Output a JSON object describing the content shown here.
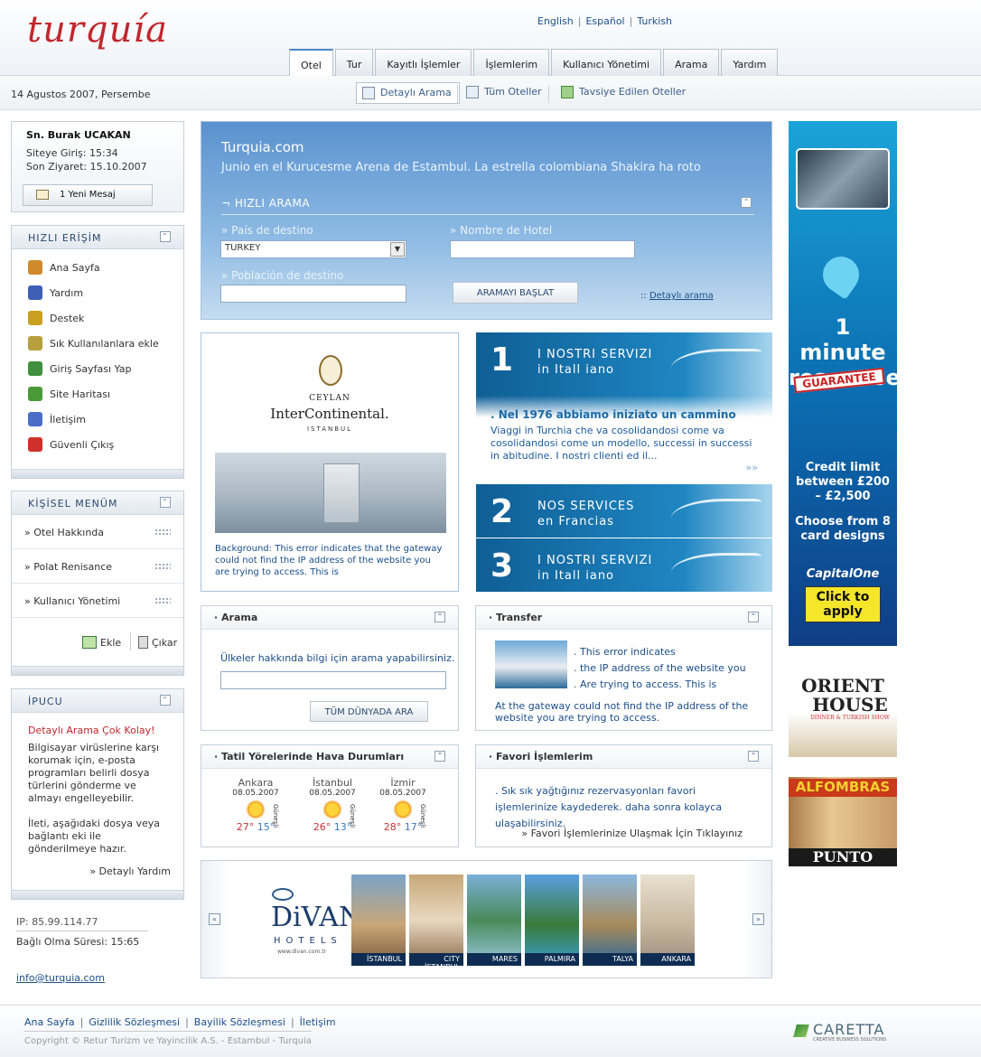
{
  "header": {
    "logo": "turquía",
    "langs": [
      "English",
      "Español",
      "Turkish"
    ],
    "tabs": [
      "Otel",
      "Tur",
      "Kayıtlı İşlemler",
      "İşlemlerim",
      "Kullanıcı Yönetimi",
      "Arama",
      "Yardım"
    ],
    "active_tab": "Otel"
  },
  "subbar": {
    "date": "14 Agustos 2007, Persembe",
    "tools": [
      "Detaylı Arama",
      "Tüm Oteller",
      "Tavsiye Edilen Oteller"
    ]
  },
  "user": {
    "name": "Sn. Burak UCAKAN",
    "login": "Siteye Giriş:  15:34",
    "last_visit": "Son Ziyaret: 15.10.2007",
    "messages": "1 Yeni Mesaj"
  },
  "quick_access": {
    "title": "HIZLI ERİŞİM",
    "items": [
      "Ana Sayfa",
      "Yardım",
      "Destek",
      "Sık Kullanılanlara ekle",
      "Giriş Sayfası Yap",
      "Site Haritası",
      "İletişim",
      "Güvenli Çıkış"
    ],
    "icon_colors": [
      "#d08a2e",
      "#3f5fb5",
      "#c9a020",
      "#b8a040",
      "#3f8f3f",
      "#4a9a3a",
      "#4a6ec8",
      "#d0302a"
    ]
  },
  "personal_menu": {
    "title": "KİŞİSEL MENÜM",
    "items": [
      "» Otel Hakkında",
      "» Polat Renisance",
      "» Kullanıcı Yönetimi"
    ],
    "add": "Ekle",
    "remove": "Çıkar"
  },
  "tip": {
    "title": "İPUCU",
    "heading": "Detaylı Arama Çok Kolay!",
    "body1": "Bilgisayar virüslerine karşı korumak için, e-posta programları belirli dosya türlerini gönderme ve almayı engelleyebilir.",
    "body2": "İleti, aşağıdaki dosya veya bağlantı eki ile gönderilmeye hazır.",
    "link": "» Detaylı Yardım"
  },
  "session": {
    "ip": "IP: 85.99.114.77",
    "duration": "Bağlı Olma Süresi: 15:65",
    "email": "info@turquia.com"
  },
  "search": {
    "site": "Turquia.com",
    "tagline": "Junio en el Kurucesme Arena de Estambul. La estrella colombiana Shakira ha roto",
    "title": "¬ HIZLI ARAMA",
    "country_label": "» País de destino",
    "country_value": "TURKEY",
    "hotel_label": "» Nombre de Hotel",
    "city_label": "» Población de destino",
    "button": "ARAMAYI BAŞLAT",
    "detail_prefix": "::",
    "detail_link": "Detaylı arama"
  },
  "hotel_promo": {
    "brand_top": "CEYLAN",
    "brand": "InterContinental.",
    "city": "ISTANBUL",
    "text": "Background: This error indicates that the gateway could not find the IP address of the website you are trying to access. This is"
  },
  "services": [
    {
      "num": "1",
      "line1": "I NOSTRI SERVIZI",
      "line2": "in Itall iano"
    },
    {
      "num": "2",
      "line1": "NOS SERVICES",
      "line2": "en Francias"
    },
    {
      "num": "3",
      "line1": "I NOSTRI SERVIZI",
      "line2": "in Itall iano"
    }
  ],
  "service_news": {
    "headline": ". Nel 1976 abbiamo iniziato un cammino",
    "body": "Viaggi in Turchia che va cosolidandosi  come va cosolidandosi  come un modello,  successi in successi in  abitudine. I nostri clienti ed il...",
    "more": "»»"
  },
  "arama_box": {
    "title": "Arama",
    "text": "Ülkeler hakkında bilgi için arama yapabilirsiniz.",
    "button": "TÜM DÜNYADA ARA"
  },
  "transfer_box": {
    "title": "Transfer",
    "lines": [
      ". This error indicates",
      ". the IP address of the website you",
      ". Are trying to access. This is"
    ],
    "footer": "At the gateway could not find the IP address of the website you are trying to access."
  },
  "weather": {
    "title": "Tatil Yörelerinde Hava Durumları",
    "cities": [
      {
        "name": "Ankara",
        "date": "08.05.2007",
        "cond": "Güneşli",
        "hi": "27°",
        "lo": "15°"
      },
      {
        "name": "İstanbul",
        "date": "08.05.2007",
        "cond": "Güneşli",
        "hi": "26°",
        "lo": "13°"
      },
      {
        "name": "İzmir",
        "date": "08.05.2007",
        "cond": "Güneşli",
        "hi": "28°",
        "lo": "17°"
      }
    ]
  },
  "favorites": {
    "title": "Favori İşlemlerim",
    "text": ". Sık sık yağtığınız rezervasyonları favori işlemlerinize kaydederek. daha sonra kolayca ulaşabilirsiniz.",
    "link": "» Favori İşlemlerinize Ulaşmak İçin Tıklayınız"
  },
  "divan": {
    "brand": "DiVAN",
    "sub": "HOTELS",
    "url": "www.divan.com.tr",
    "photos": [
      "İSTANBUL",
      "CITY İSTANBUL",
      "MARES",
      "PALMIRA",
      "TALYA",
      "ANKARA"
    ]
  },
  "ads": {
    "capital_one": {
      "headline": "1 minute response",
      "badge": "GUARANTEE",
      "limit": "Credit limit between £200 – £2,500",
      "designs": "Choose from 8 card designs",
      "brand": "CapitalOne",
      "cta": "Click to apply"
    },
    "orient": {
      "line1": "ORIENT",
      "line2": "HOUSE",
      "line3": "DINNER & TURKISH SHOW"
    },
    "alfombras": {
      "top": "ALFOMBRAS",
      "bottom": "PUNTO"
    }
  },
  "footer": {
    "links": [
      "Ana Sayfa",
      "Gizlilik Sözleşmesi",
      "Bayilik Sözleşmesi",
      "İletişim"
    ],
    "copyright": "Copyright © Retur Turizm ve Yayincilik A.S. - Estambul - Turquia",
    "brand": "CARETTA",
    "brand_sub": "CREATIVE BUSINESS SOLUTIONS"
  },
  "colors": {
    "accent": "#1c4f8a",
    "logo_red": "#c0272d",
    "tip_red": "#c0272d"
  }
}
